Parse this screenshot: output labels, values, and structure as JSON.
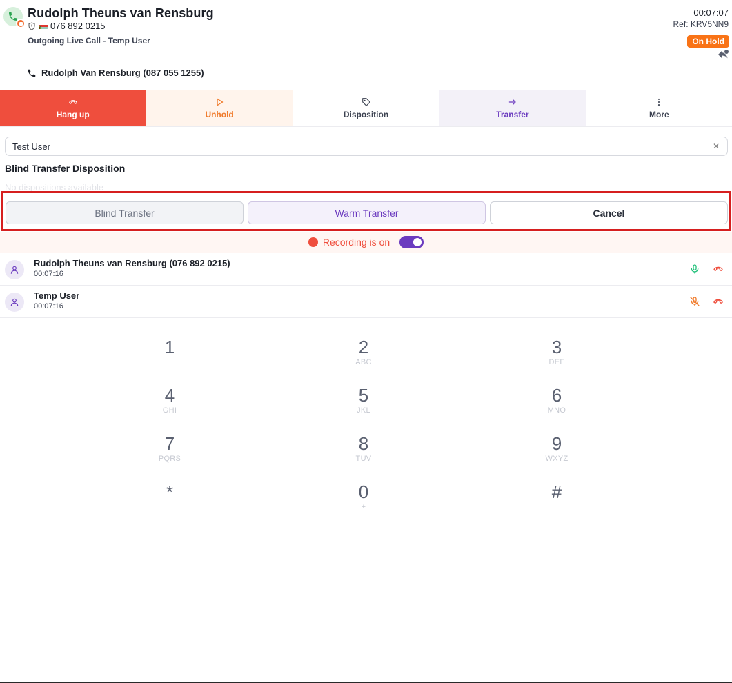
{
  "header": {
    "caller_name": "Rudolph Theuns van Rensburg",
    "caller_number": "076 892 0215",
    "call_type": "Outgoing Live Call - Temp User",
    "timer": "00:07:07",
    "ref": "Ref: KRV5NN9",
    "status_badge": "On Hold",
    "line_info": "Rudolph Van Rensburg (087 055 1255)"
  },
  "actions": {
    "hangup": "Hang up",
    "unhold": "Unhold",
    "disposition": "Disposition",
    "transfer": "Transfer",
    "more": "More"
  },
  "transfer": {
    "search_value": "Test User",
    "section_title": "Blind Transfer Disposition",
    "no_dispositions": "No dispositions available",
    "blind_label": "Blind Transfer",
    "warm_label": "Warm Transfer",
    "cancel_label": "Cancel"
  },
  "recording": {
    "label": "Recording is on",
    "enabled": true
  },
  "participants": [
    {
      "name": "Rudolph Theuns van Rensburg (076 892 0215)",
      "time": "00:07:16",
      "muted": false
    },
    {
      "name": "Temp User",
      "time": "00:07:16",
      "muted": true
    }
  ],
  "dialpad": [
    {
      "digit": "1",
      "letters": ""
    },
    {
      "digit": "2",
      "letters": "ABC"
    },
    {
      "digit": "3",
      "letters": "DEF"
    },
    {
      "digit": "4",
      "letters": "GHI"
    },
    {
      "digit": "5",
      "letters": "JKL"
    },
    {
      "digit": "6",
      "letters": "MNO"
    },
    {
      "digit": "7",
      "letters": "PQRS"
    },
    {
      "digit": "8",
      "letters": "TUV"
    },
    {
      "digit": "9",
      "letters": "WXYZ"
    },
    {
      "digit": "*",
      "letters": ""
    },
    {
      "digit": "0",
      "letters": "+"
    },
    {
      "digit": "#",
      "letters": ""
    }
  ],
  "colors": {
    "hangup": "#ef4e3d",
    "hold_orange": "#f97316",
    "accent_purple": "#6b3bbf",
    "mic_green": "#22c07a",
    "highlight_red": "#d61f1f"
  }
}
